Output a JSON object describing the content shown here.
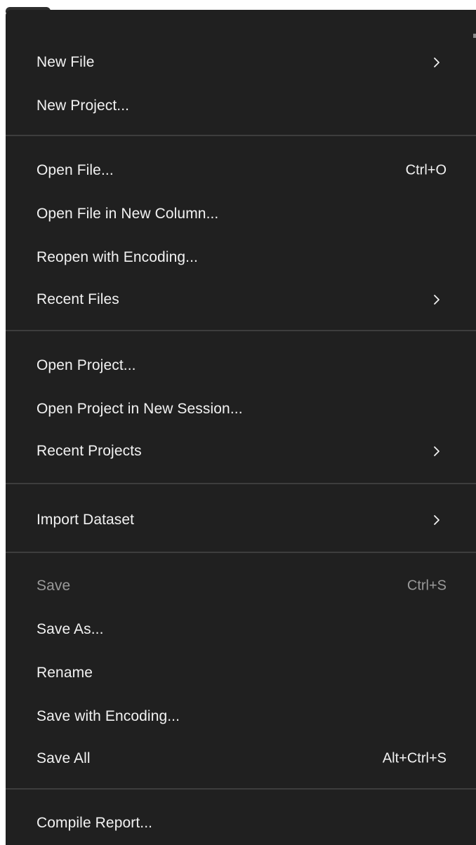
{
  "menu": {
    "items": [
      {
        "label": "New File",
        "shortcut": "",
        "submenu": true
      },
      {
        "label": "New Project...",
        "shortcut": "",
        "submenu": false
      },
      {
        "label": "Open File...",
        "shortcut": "Ctrl+O",
        "submenu": false
      },
      {
        "label": "Open File in New Column...",
        "shortcut": "",
        "submenu": false
      },
      {
        "label": "Reopen with Encoding...",
        "shortcut": "",
        "submenu": false
      },
      {
        "label": "Recent Files",
        "shortcut": "",
        "submenu": true
      },
      {
        "label": "Open Project...",
        "shortcut": "",
        "submenu": false
      },
      {
        "label": "Open Project in New Session...",
        "shortcut": "",
        "submenu": false
      },
      {
        "label": "Recent Projects",
        "shortcut": "",
        "submenu": true
      },
      {
        "label": "Import Dataset",
        "shortcut": "",
        "submenu": true
      },
      {
        "label": "Save",
        "shortcut": "Ctrl+S",
        "submenu": false,
        "disabled": true
      },
      {
        "label": "Save As...",
        "shortcut": "",
        "submenu": false
      },
      {
        "label": "Rename",
        "shortcut": "",
        "submenu": false
      },
      {
        "label": "Save with Encoding...",
        "shortcut": "",
        "submenu": false
      },
      {
        "label": "Save All",
        "shortcut": "Alt+Ctrl+S",
        "submenu": false
      },
      {
        "label": "Compile Report...",
        "shortcut": "",
        "submenu": false
      }
    ]
  },
  "colors": {
    "menu_background": "#202020",
    "text": "#f2f2f2",
    "disabled_text": "#9a9a9a",
    "separator": "#3d3d3d"
  },
  "icons": {
    "submenu": "chevron-right-icon"
  }
}
